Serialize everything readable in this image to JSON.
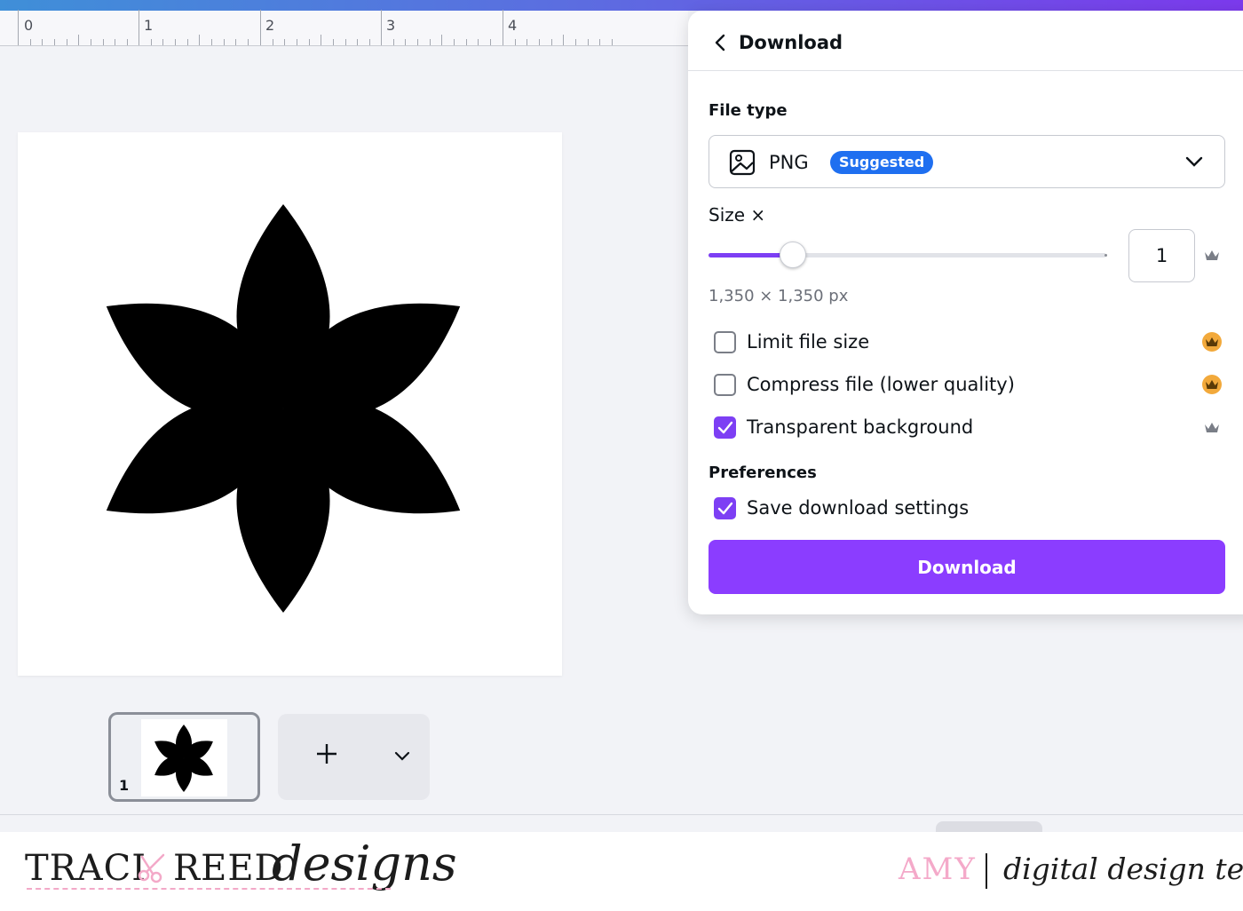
{
  "ruler": {
    "marks": [
      "0",
      "1",
      "2",
      "3",
      "4"
    ]
  },
  "pages": {
    "current_number": "1"
  },
  "panel": {
    "title": "Download",
    "file_type": {
      "label": "File type",
      "value": "PNG",
      "badge": "Suggested"
    },
    "size": {
      "label": "Size ×",
      "scale": 0.16,
      "input_value": "1",
      "dimensions": "1,350 × 1,350 px"
    },
    "options": [
      {
        "label": "Limit file size",
        "checked": false,
        "crown": "gold"
      },
      {
        "label": "Compress file (lower quality)",
        "checked": false,
        "crown": "gold"
      },
      {
        "label": "Transparent background",
        "checked": true,
        "crown": "gray"
      }
    ],
    "preferences": {
      "label": "Preferences",
      "save_settings_label": "Save download settings",
      "checked": true
    },
    "download_button": "Download"
  },
  "footer": {
    "brand_left": "TRACI",
    "brand_right": "REED",
    "brand_script": "designs",
    "member": "AMY",
    "team": "digital design team"
  },
  "colors": {
    "accent": "#8b3dff",
    "badge": "#1f6ff0",
    "crown_gold": "#f2a93b",
    "footer_pink": "#f4a9c9"
  }
}
